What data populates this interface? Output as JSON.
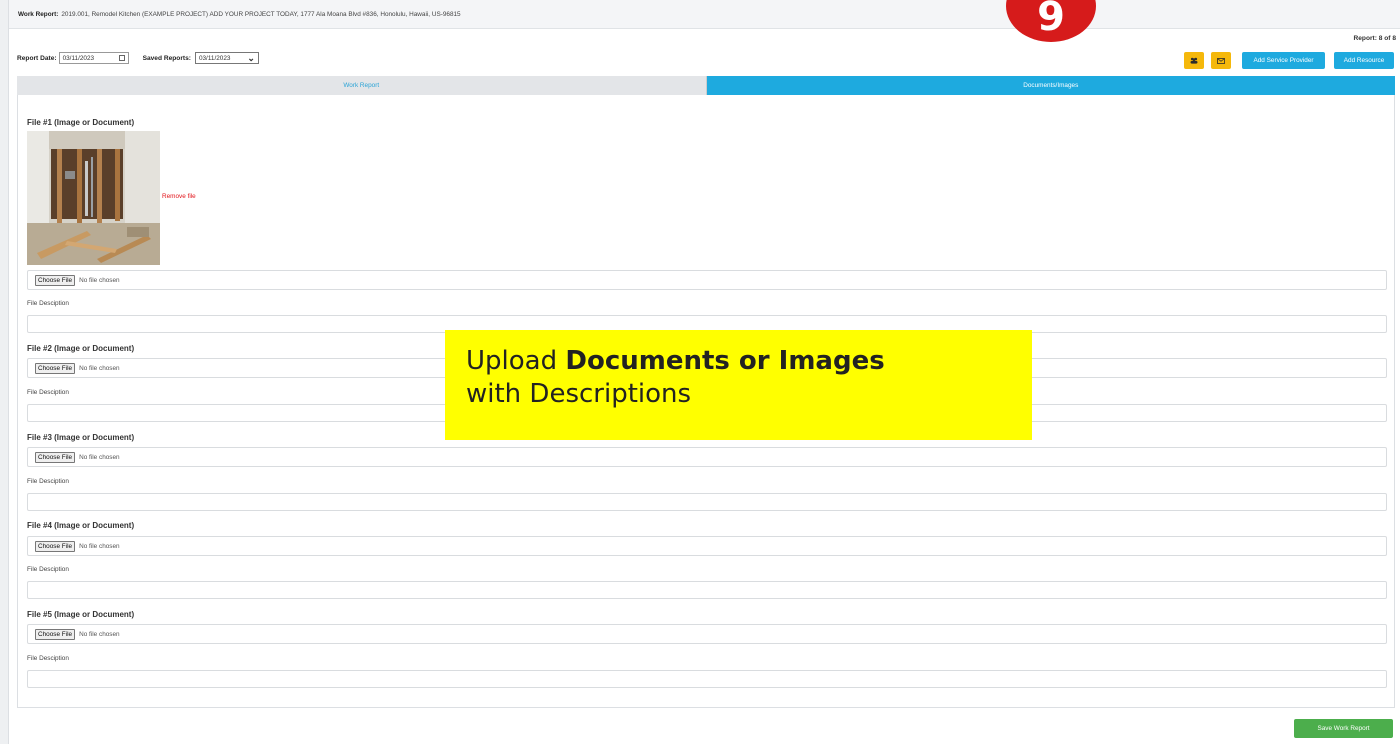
{
  "header": {
    "label": "Work Report:",
    "text": "2019.001, Remodel Kitchen (EXAMPLE PROJECT) ADD YOUR PROJECT TODAY, 1777 Ala Moana Blvd #836, Honolulu, Hawaii, US-96815"
  },
  "step_badge": "9",
  "report_count": "Report: 8 of 8",
  "controls": {
    "report_date_label": "Report Date:",
    "report_date_value": "03/11/2023",
    "saved_reports_label": "Saved Reports:",
    "saved_reports_value": "03/11/2023"
  },
  "toolbar": {
    "icon_button_1": "users-icon",
    "icon_button_2": "envelope-icon",
    "add_service_provider": "Add Service Provider",
    "add_resource": "Add Resource"
  },
  "tabs": [
    {
      "label": "Work Report",
      "active": false
    },
    {
      "label": "Documents/Images",
      "active": true
    }
  ],
  "files": [
    {
      "title": "File #1 (Image or Document)",
      "choose": "Choose File",
      "status": "No file chosen",
      "desc_label": "File Desciption",
      "remove": "Remove file"
    },
    {
      "title": "File #2 (Image or Document)",
      "choose": "Choose File",
      "status": "No file chosen",
      "desc_label": "File Desciption"
    },
    {
      "title": "File #3 (Image or Document)",
      "choose": "Choose File",
      "status": "No file chosen",
      "desc_label": "File Desciption"
    },
    {
      "title": "File #4 (Image or Document)",
      "choose": "Choose File",
      "status": "No file chosen",
      "desc_label": "File Desciption"
    },
    {
      "title": "File #5 (Image or Document)",
      "choose": "Choose File",
      "status": "No file chosen",
      "desc_label": "File Desciption"
    }
  ],
  "callout": {
    "prefix": "Upload ",
    "bold": "Documents or Images",
    "line2": "with Descriptions"
  },
  "save_button": "Save Work Report",
  "colors": {
    "accent_blue": "#1eaadf",
    "warning_yellow": "#f5b80b",
    "save_green": "#4cae4c",
    "badge_red": "#d61b1b",
    "callout_yellow": "#ffff00"
  }
}
